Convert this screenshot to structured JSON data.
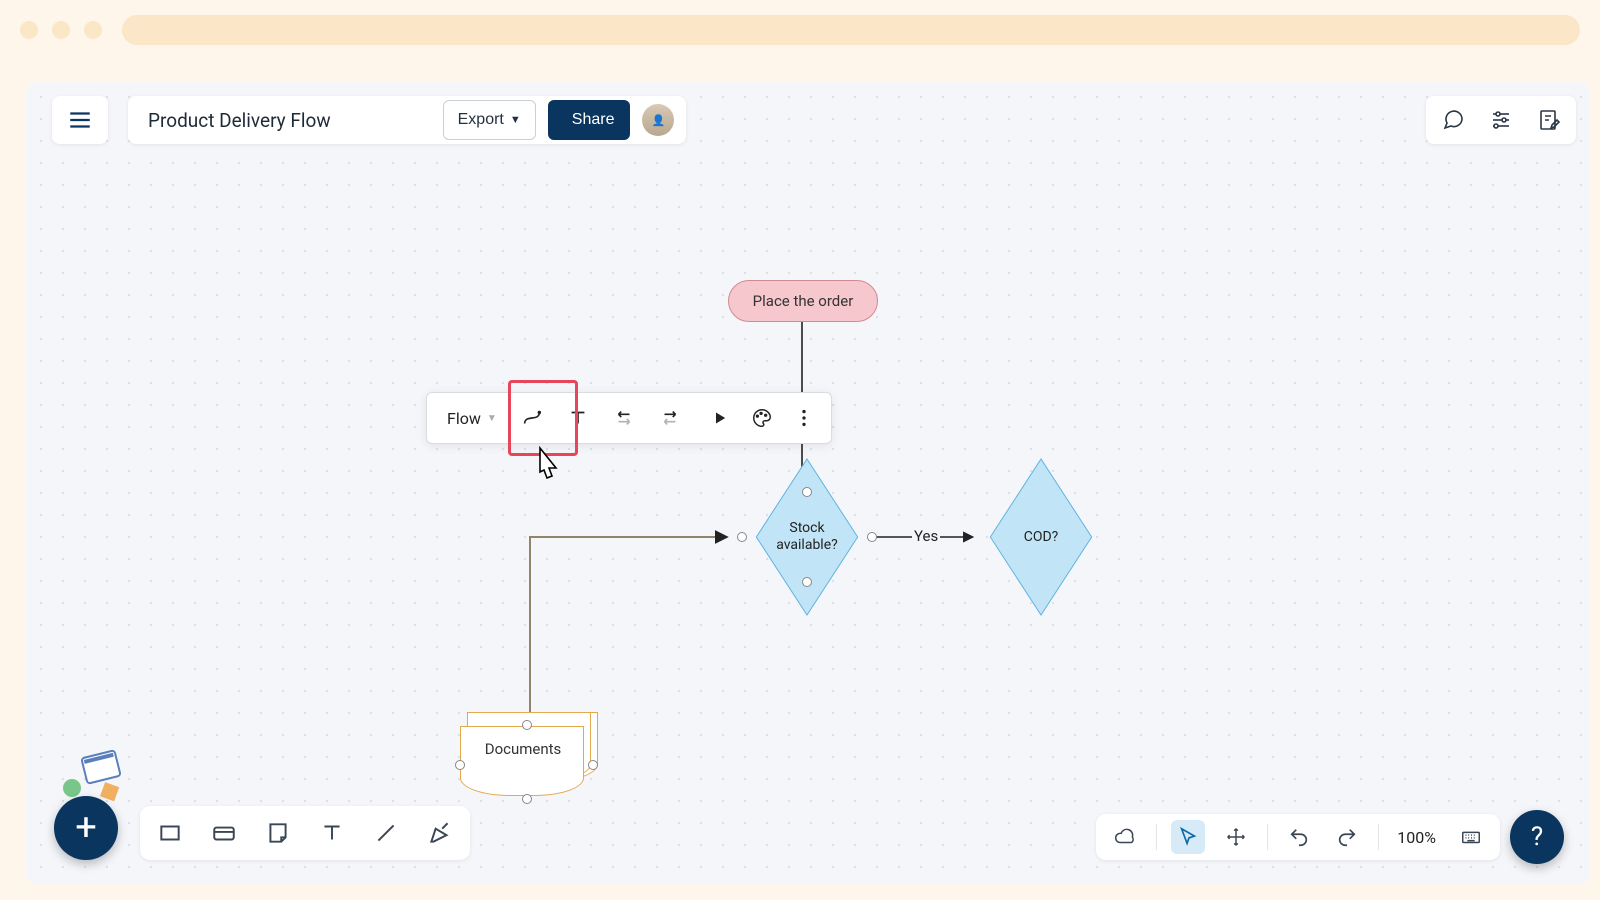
{
  "header": {
    "title": "Product Delivery Flow",
    "export_label": "Export",
    "share_label": "Share"
  },
  "nodes": {
    "order_label": "Place the order",
    "stock_label": "Stock\navailable?",
    "cod_label": "COD?",
    "docs_label": "Documents"
  },
  "edges": {
    "yes_label": "Yes"
  },
  "context_toolbar": {
    "flow_label": "Flow"
  },
  "status": {
    "zoom": "100%"
  }
}
